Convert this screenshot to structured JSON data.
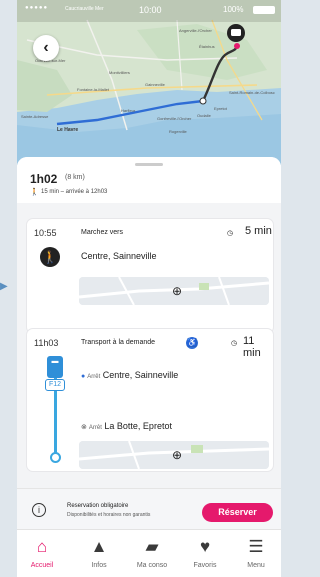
{
  "status_bar": {
    "carrier": "●●●●●",
    "carrier_name": "Caucriauville Mer",
    "time": "10:00",
    "battery": "100%"
  },
  "map": {
    "places": {
      "le_havre": "Le Havre",
      "harfleur": "Harfleur",
      "gonfreville": "Gonfreville-l'Orcher",
      "epretot": "Epretot",
      "oudalle": "Oudalle",
      "sainte_adresse": "Sainte-Adresse",
      "saint_romain": "Saint-Romain-de-Colbosc",
      "fontaine": "Fontaine-la-Mallet",
      "angerville": "Angerville-l'Orcher",
      "octeville": "Octeville-sur-Mer",
      "gainneville": "Gainneville",
      "etainhus": "Étainhus",
      "rogerville": "Rogerville",
      "montivilliers": "Montivilliers"
    }
  },
  "summary": {
    "duration": "1h02",
    "distance": "(8 km)",
    "detail": "15 min – arrivée à 12h03"
  },
  "steps": [
    {
      "time": "10:55",
      "title": "Marchez vers",
      "duration": "5 min",
      "place": "Centre, Sainneville"
    },
    {
      "time": "11h03",
      "title": "Transport à la demande",
      "duration": "11 min",
      "line": "F12",
      "stop_prefix": "Arrêt",
      "from": "Centre, Sainneville",
      "to": "La Botte, Epretot"
    }
  ],
  "reservation": {
    "title": "Reservation obligatoire",
    "subtitle": "Disponibilités et horaires non garantis",
    "button": "Réserver"
  },
  "tabs": [
    {
      "label": "Accueil",
      "icon": "home-icon",
      "active": true
    },
    {
      "label": "Infos",
      "icon": "warning-icon",
      "active": false
    },
    {
      "label": "Ma conso",
      "icon": "wallet-icon",
      "active": false
    },
    {
      "label": "Favoris",
      "icon": "heart-icon",
      "active": false
    },
    {
      "label": "Menu",
      "icon": "menu-icon",
      "active": false
    }
  ],
  "colors": {
    "accent": "#e5196c",
    "route_blue": "#3aa7e0",
    "route_dark": "#333333"
  }
}
